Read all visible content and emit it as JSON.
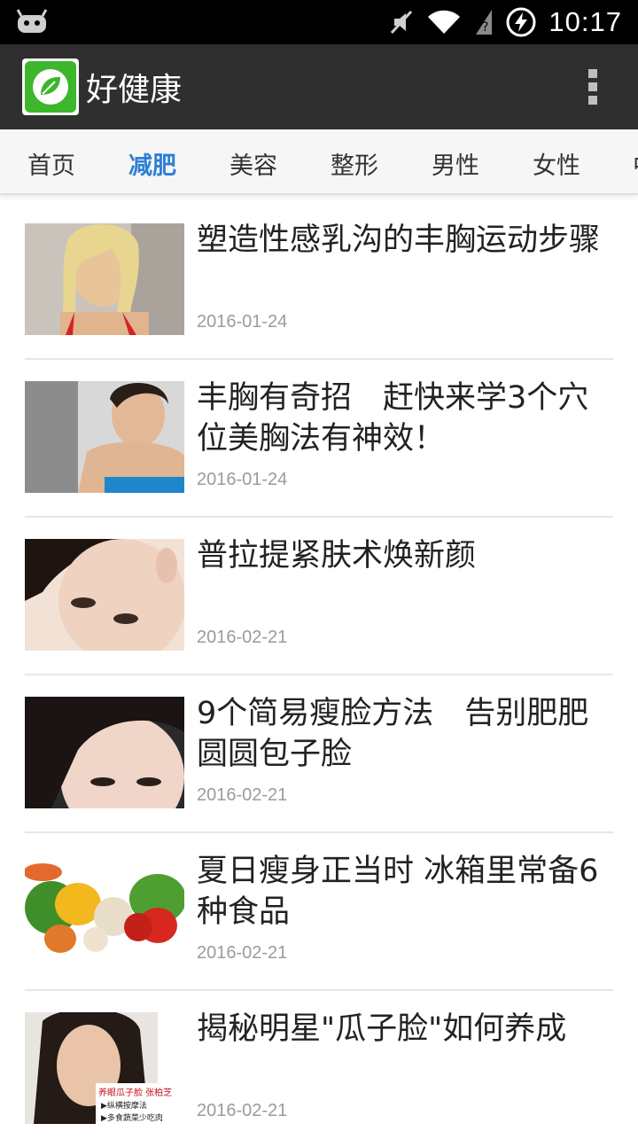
{
  "status_bar": {
    "time": "10:17"
  },
  "app": {
    "title": "好健康"
  },
  "tabs": [
    {
      "label": "首页",
      "active": false
    },
    {
      "label": "减肥",
      "active": true
    },
    {
      "label": "美容",
      "active": false
    },
    {
      "label": "整形",
      "active": false
    },
    {
      "label": "男性",
      "active": false
    },
    {
      "label": "女性",
      "active": false
    },
    {
      "label": "中",
      "active": false
    }
  ],
  "articles": [
    {
      "title": "塑造性感乳沟的丰胸运动步骤",
      "date": "2016-01-24"
    },
    {
      "title": "丰胸有奇招　赶快来学3个穴位美胸法有神效！",
      "date": "2016-01-24"
    },
    {
      "title": "普拉提紧肤术焕新颜",
      "date": "2016-02-21"
    },
    {
      "title": "9个简易瘦脸方法　告别肥肥圆圆包子脸",
      "date": "2016-02-21"
    },
    {
      "title": "夏日瘦身正当时 冰箱里常备6种食品",
      "date": "2016-02-21"
    },
    {
      "title": "揭秘明星\"瓜子脸\"如何养成",
      "date": "2016-02-21"
    }
  ],
  "thumb6_caption": {
    "line1": "养眼瓜子脸  张柏芝",
    "line2": "▶纵横按摩法",
    "line3": "▶多食蔬菜少吃肉"
  }
}
